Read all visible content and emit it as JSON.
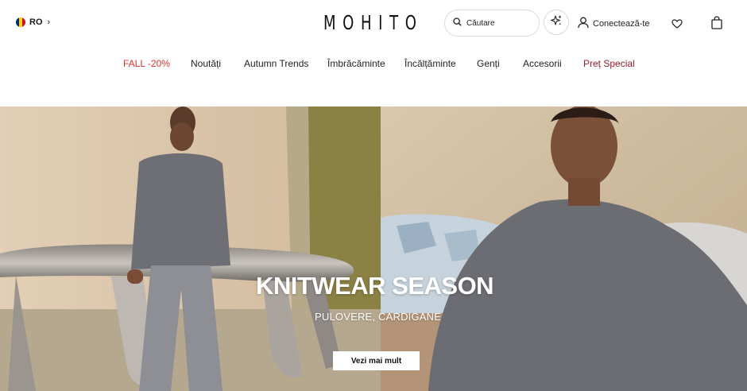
{
  "header": {
    "region": {
      "code": "RO",
      "flag_colors": [
        "#002B7F",
        "#FCD116",
        "#CE1126"
      ]
    },
    "logo": "MOHITO",
    "search": {
      "placeholder": "Căutare"
    },
    "ai_icon": "sparkle-ai-icon",
    "login_label": "Conectează-te",
    "wishlist_icon": "heart-icon",
    "bag_icon": "shopping-bag-icon"
  },
  "nav": {
    "items": [
      {
        "label": "FALL -20%",
        "color": "#e0312c"
      },
      {
        "label": "Noutăți"
      },
      {
        "label": "Autumn Trends"
      },
      {
        "label": "Îmbrăcăminte"
      },
      {
        "label": "Încălțăminte"
      },
      {
        "label": "Genți"
      },
      {
        "label": "Accesorii"
      },
      {
        "label": "Preț Special",
        "color": "#9b1c2c"
      }
    ]
  },
  "hero": {
    "title": "KNITWEAR SEASON",
    "subtitle": "PULOVERE, CARDIGANE",
    "cta_label": "Vezi mai mult"
  }
}
